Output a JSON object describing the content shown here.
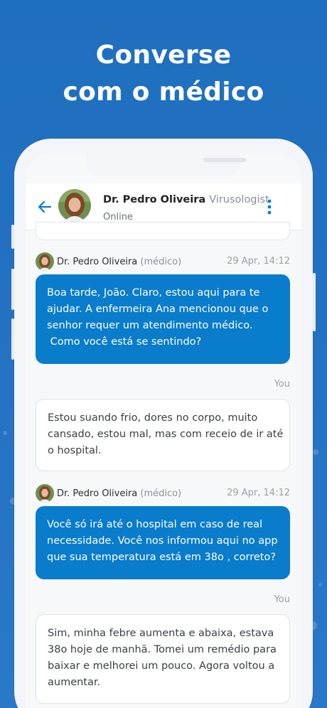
{
  "headline": {
    "line1": "Converse",
    "line2": "com o médico"
  },
  "chat": {
    "doctor_name": "Dr. Pedro Oliveira",
    "doctor_specialty": "Virusologist",
    "status": "Online"
  },
  "messages": [
    {
      "sender": "Dr. Pedro Oliveira",
      "role": "(médico)",
      "time": "29 Apr, 14:12",
      "lines": [
        "Boa tarde, João. Claro, estou aqui para te",
        "ajudar. A enfermeira Ana mencionou que o",
        "senhor requer um atendimento médico.",
        " Como você está se sentindo?"
      ]
    },
    {
      "sender_label": "You",
      "lines": [
        "Estou suando frio, dores no corpo, muito",
        "cansado, estou mal, mas com receio de ir até",
        "o hospital."
      ]
    },
    {
      "sender": "Dr. Pedro Oliveira",
      "role": "(médico)",
      "time": "29 Apr, 14:12",
      "lines": [
        "Você só irá até o hospital em caso de real",
        "necessidade. Você nos informou aqui no app",
        "que sua temperatura está em 38o , correto?"
      ]
    },
    {
      "sender_label": "You",
      "lines": [
        "Sim, minha febre aumenta e abaixa, estava",
        "38o hoje de manhã. Tomei um remédio para",
        "baixar e melhorei um pouco. Agora voltou a",
        "aumentar."
      ]
    }
  ],
  "colors": {
    "background": "#1f6fbf",
    "doctor_bubble": "#0a7ccc",
    "accent": "#0a7ccc"
  },
  "icons": {
    "back": "arrow-left-icon",
    "more": "more-vertical-icon"
  }
}
